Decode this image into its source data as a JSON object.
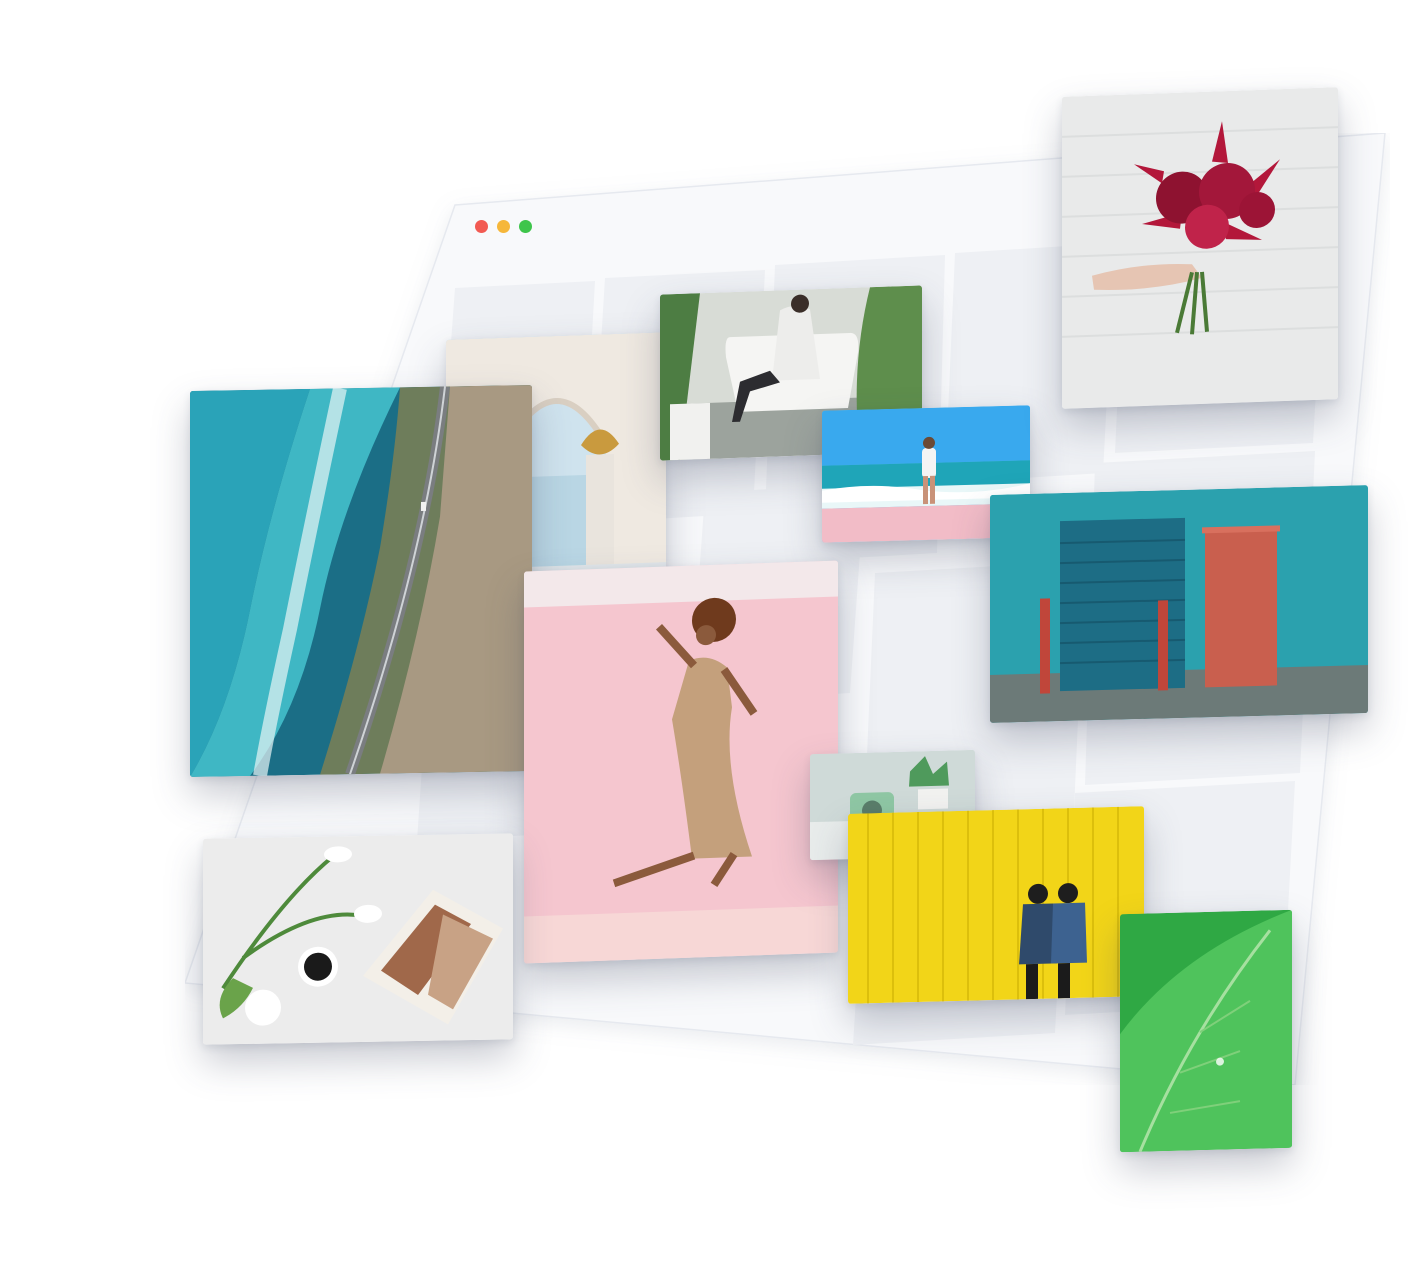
{
  "window": {
    "traffic_lights": [
      {
        "name": "close",
        "color": "#f25a52"
      },
      {
        "name": "minimize",
        "color": "#f6b73a"
      },
      {
        "name": "maximize",
        "color": "#3ec54b"
      }
    ],
    "frame_color": "#f8f9fb",
    "placeholder_color": "#eef0f4"
  },
  "photos": [
    {
      "id": "aerial-coast",
      "subject": "aerial-coastline-road"
    },
    {
      "id": "arch-terrace",
      "subject": "archway-person-terrace"
    },
    {
      "id": "bathtub-plants",
      "subject": "person-sitting-bathtub-plants"
    },
    {
      "id": "beach-waves",
      "subject": "person-walking-beach-waves"
    },
    {
      "id": "red-lilies",
      "subject": "hand-holding-red-lilies"
    },
    {
      "id": "teal-building",
      "subject": "teal-building-red-door"
    },
    {
      "id": "pink-jump",
      "subject": "woman-jumping-pink-wall"
    },
    {
      "id": "desk-camera",
      "subject": "green-camera-succulent-desk"
    },
    {
      "id": "yellow-wall",
      "subject": "two-girls-yellow-wall"
    },
    {
      "id": "green-leaf",
      "subject": "green-leaf-closeup"
    },
    {
      "id": "tulips-coffee",
      "subject": "tulips-coffee-magazine-flatlay"
    }
  ]
}
